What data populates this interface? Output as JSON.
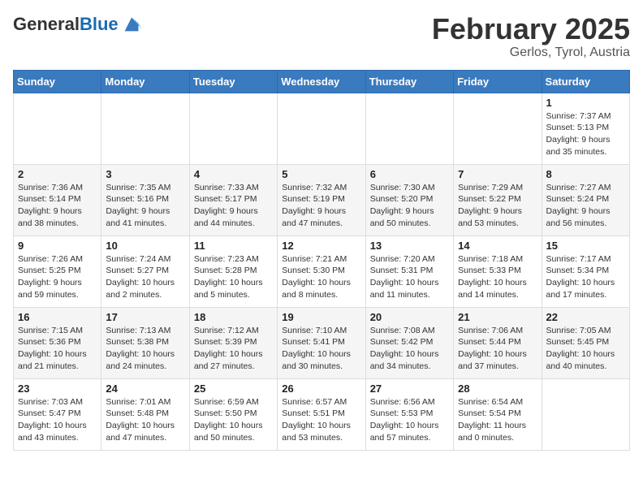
{
  "header": {
    "logo_general": "General",
    "logo_blue": "Blue",
    "month_title": "February 2025",
    "location": "Gerlos, Tyrol, Austria"
  },
  "weekdays": [
    "Sunday",
    "Monday",
    "Tuesday",
    "Wednesday",
    "Thursday",
    "Friday",
    "Saturday"
  ],
  "weeks": [
    [
      {
        "day": "",
        "info": ""
      },
      {
        "day": "",
        "info": ""
      },
      {
        "day": "",
        "info": ""
      },
      {
        "day": "",
        "info": ""
      },
      {
        "day": "",
        "info": ""
      },
      {
        "day": "",
        "info": ""
      },
      {
        "day": "1",
        "info": "Sunrise: 7:37 AM\nSunset: 5:13 PM\nDaylight: 9 hours and 35 minutes."
      }
    ],
    [
      {
        "day": "2",
        "info": "Sunrise: 7:36 AM\nSunset: 5:14 PM\nDaylight: 9 hours and 38 minutes."
      },
      {
        "day": "3",
        "info": "Sunrise: 7:35 AM\nSunset: 5:16 PM\nDaylight: 9 hours and 41 minutes."
      },
      {
        "day": "4",
        "info": "Sunrise: 7:33 AM\nSunset: 5:17 PM\nDaylight: 9 hours and 44 minutes."
      },
      {
        "day": "5",
        "info": "Sunrise: 7:32 AM\nSunset: 5:19 PM\nDaylight: 9 hours and 47 minutes."
      },
      {
        "day": "6",
        "info": "Sunrise: 7:30 AM\nSunset: 5:20 PM\nDaylight: 9 hours and 50 minutes."
      },
      {
        "day": "7",
        "info": "Sunrise: 7:29 AM\nSunset: 5:22 PM\nDaylight: 9 hours and 53 minutes."
      },
      {
        "day": "8",
        "info": "Sunrise: 7:27 AM\nSunset: 5:24 PM\nDaylight: 9 hours and 56 minutes."
      }
    ],
    [
      {
        "day": "9",
        "info": "Sunrise: 7:26 AM\nSunset: 5:25 PM\nDaylight: 9 hours and 59 minutes."
      },
      {
        "day": "10",
        "info": "Sunrise: 7:24 AM\nSunset: 5:27 PM\nDaylight: 10 hours and 2 minutes."
      },
      {
        "day": "11",
        "info": "Sunrise: 7:23 AM\nSunset: 5:28 PM\nDaylight: 10 hours and 5 minutes."
      },
      {
        "day": "12",
        "info": "Sunrise: 7:21 AM\nSunset: 5:30 PM\nDaylight: 10 hours and 8 minutes."
      },
      {
        "day": "13",
        "info": "Sunrise: 7:20 AM\nSunset: 5:31 PM\nDaylight: 10 hours and 11 minutes."
      },
      {
        "day": "14",
        "info": "Sunrise: 7:18 AM\nSunset: 5:33 PM\nDaylight: 10 hours and 14 minutes."
      },
      {
        "day": "15",
        "info": "Sunrise: 7:17 AM\nSunset: 5:34 PM\nDaylight: 10 hours and 17 minutes."
      }
    ],
    [
      {
        "day": "16",
        "info": "Sunrise: 7:15 AM\nSunset: 5:36 PM\nDaylight: 10 hours and 21 minutes."
      },
      {
        "day": "17",
        "info": "Sunrise: 7:13 AM\nSunset: 5:38 PM\nDaylight: 10 hours and 24 minutes."
      },
      {
        "day": "18",
        "info": "Sunrise: 7:12 AM\nSunset: 5:39 PM\nDaylight: 10 hours and 27 minutes."
      },
      {
        "day": "19",
        "info": "Sunrise: 7:10 AM\nSunset: 5:41 PM\nDaylight: 10 hours and 30 minutes."
      },
      {
        "day": "20",
        "info": "Sunrise: 7:08 AM\nSunset: 5:42 PM\nDaylight: 10 hours and 34 minutes."
      },
      {
        "day": "21",
        "info": "Sunrise: 7:06 AM\nSunset: 5:44 PM\nDaylight: 10 hours and 37 minutes."
      },
      {
        "day": "22",
        "info": "Sunrise: 7:05 AM\nSunset: 5:45 PM\nDaylight: 10 hours and 40 minutes."
      }
    ],
    [
      {
        "day": "23",
        "info": "Sunrise: 7:03 AM\nSunset: 5:47 PM\nDaylight: 10 hours and 43 minutes."
      },
      {
        "day": "24",
        "info": "Sunrise: 7:01 AM\nSunset: 5:48 PM\nDaylight: 10 hours and 47 minutes."
      },
      {
        "day": "25",
        "info": "Sunrise: 6:59 AM\nSunset: 5:50 PM\nDaylight: 10 hours and 50 minutes."
      },
      {
        "day": "26",
        "info": "Sunrise: 6:57 AM\nSunset: 5:51 PM\nDaylight: 10 hours and 53 minutes."
      },
      {
        "day": "27",
        "info": "Sunrise: 6:56 AM\nSunset: 5:53 PM\nDaylight: 10 hours and 57 minutes."
      },
      {
        "day": "28",
        "info": "Sunrise: 6:54 AM\nSunset: 5:54 PM\nDaylight: 11 hours and 0 minutes."
      },
      {
        "day": "",
        "info": ""
      }
    ]
  ]
}
